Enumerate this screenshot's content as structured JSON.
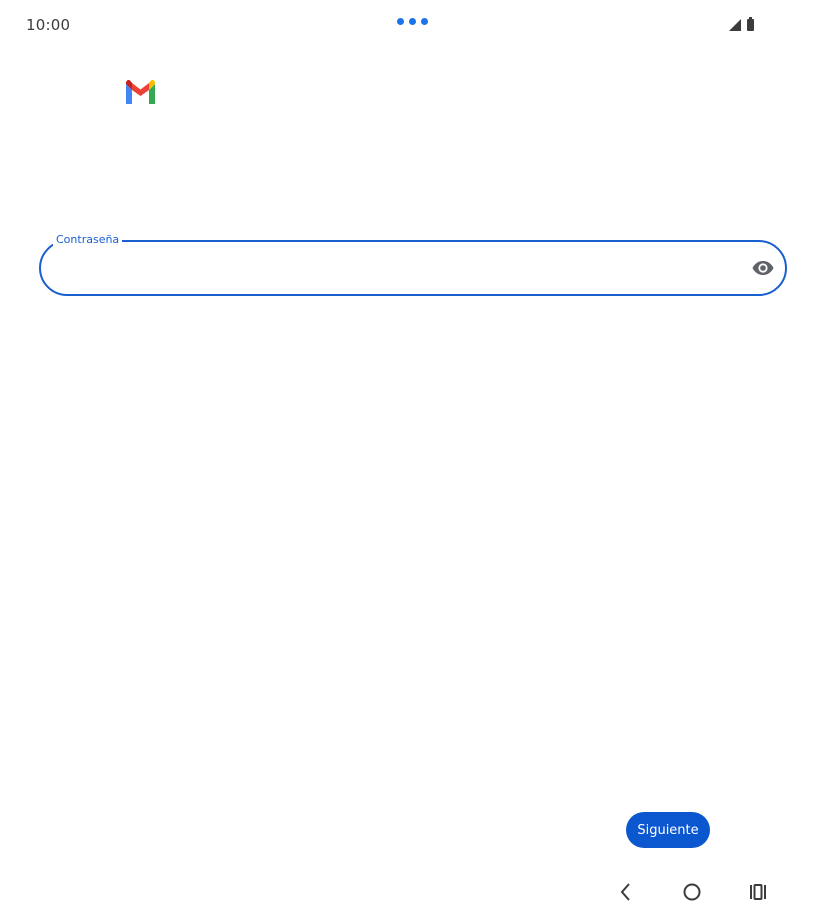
{
  "status_bar": {
    "time": "10:00"
  },
  "app": {
    "logo_icon": "gmail-logo-icon"
  },
  "password_field": {
    "label": "Contraseña",
    "value": "",
    "toggle_icon": "eye-icon"
  },
  "actions": {
    "next_label": "Siguiente"
  },
  "nav_bar": {
    "back_icon": "back-chevron-icon",
    "home_icon": "home-circle-icon",
    "recents_icon": "recents-icon"
  },
  "colors": {
    "accent": "#1a5fcf",
    "button": "#0b57d0",
    "loading_dots": "#1a73e8"
  }
}
